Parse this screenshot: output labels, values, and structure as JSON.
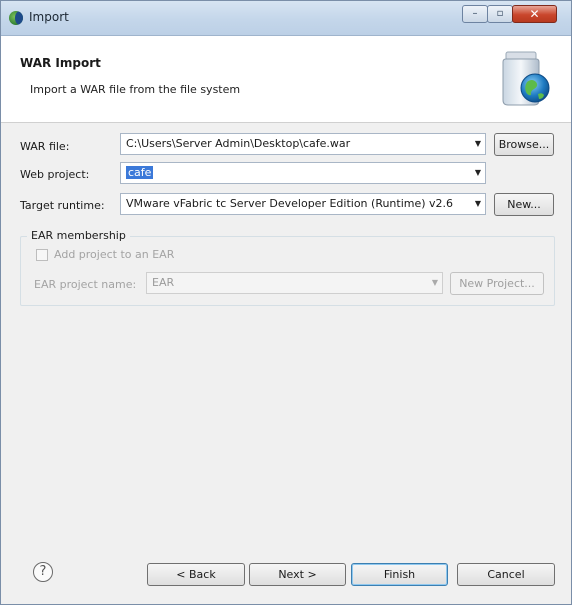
{
  "window": {
    "title": "Import",
    "minimize_glyph": "–",
    "maximize_glyph": "▫",
    "close_glyph": "✕"
  },
  "banner": {
    "title": "WAR Import",
    "description": "Import a WAR file from the file system",
    "icon": "jar-globe-icon"
  },
  "form": {
    "war_file": {
      "label": "WAR file:",
      "value": "C:\\Users\\Server Admin\\Desktop\\cafe.war",
      "browse_label": "Browse..."
    },
    "web_project": {
      "label": "Web project:",
      "value": "cafe"
    },
    "target_runtime": {
      "label": "Target runtime:",
      "value": "VMware vFabric tc Server Developer Edition (Runtime) v2.6",
      "new_label": "New..."
    },
    "ear_membership": {
      "group_title": "EAR membership",
      "add_to_ear_label": "Add project to an EAR",
      "add_to_ear_checked": false,
      "ear_project_label": "EAR project name:",
      "ear_project_value": "EAR",
      "new_project_label": "New Project..."
    }
  },
  "footer": {
    "help_glyph": "?",
    "back_label": "< Back",
    "next_label": "Next >",
    "finish_label": "Finish",
    "cancel_label": "Cancel"
  },
  "colors": {
    "selection": "#3b79d9",
    "titlebar": "#c4d6ea",
    "close_button": "#c9462c"
  }
}
